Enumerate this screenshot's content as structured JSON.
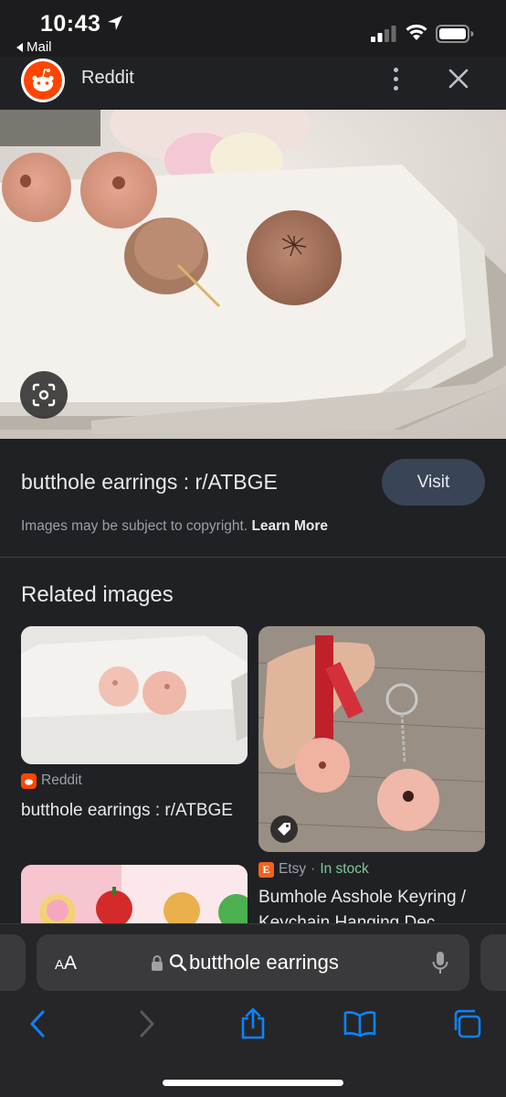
{
  "status_bar": {
    "time": "10:43",
    "back_app_label": "Mail"
  },
  "header": {
    "site_name": "Reddit"
  },
  "result": {
    "title": "butthole earrings : r/ATBGE",
    "visit_label": "Visit",
    "copyright_text": "Images may be subject to copyright.",
    "learn_more_label": "Learn More"
  },
  "related": {
    "heading": "Related images",
    "items": [
      {
        "source": "Reddit",
        "caption": "butthole earrings : r/ATBGE"
      },
      {
        "source": "Etsy",
        "separator": " · ",
        "stock": "In stock",
        "caption": "Bumhole Asshole Keyring / Keychain Hanging Dec..."
      }
    ]
  },
  "safari": {
    "aa_label_small": "A",
    "aa_label_big": "A",
    "address_text": "butthole earrings"
  },
  "colors": {
    "background": "#202124",
    "visit_button": "#394457",
    "safari_accent": "#0a84ff",
    "in_stock": "#81c995"
  }
}
